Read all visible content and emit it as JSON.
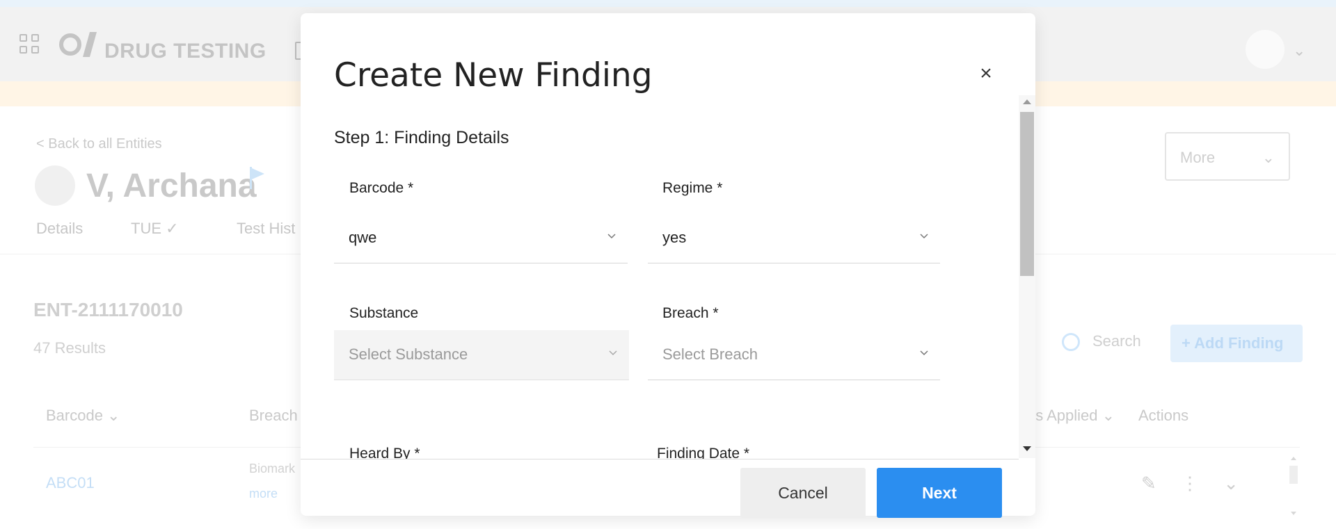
{
  "app": {
    "title": "DRUG TESTING"
  },
  "entity": {
    "back_label": "< Back to all Entities",
    "name": "V, Archana",
    "tabs": [
      {
        "label": "Details"
      },
      {
        "label": "TUE ✓"
      },
      {
        "label": "Test Hist"
      }
    ],
    "more_label": "More",
    "id": "ENT-2111170010",
    "results": "47 Results",
    "search_label": "Search",
    "add_finding_label": "+ Add Finding",
    "table_headers": [
      "Barcode ⌄",
      "Breach",
      "ns Applied ⌄",
      "Actions"
    ],
    "rows": [
      {
        "barcode": "ABC01",
        "breach": "Biomark",
        "more": "more"
      }
    ]
  },
  "modal": {
    "title": "Create New Finding",
    "close_label": "×",
    "step_title": "Step 1: Finding Details",
    "fields": {
      "barcode": {
        "label": "Barcode *",
        "value": "qwe"
      },
      "regime": {
        "label": "Regime *",
        "value": "yes"
      },
      "substance": {
        "label": "Substance",
        "placeholder": "Select Substance",
        "disabled": true
      },
      "breach": {
        "label": "Breach *",
        "placeholder": "Select Breach"
      },
      "heard_by": {
        "label": "Heard By *"
      },
      "finding_date": {
        "label": "Finding Date *"
      }
    },
    "cancel_label": "Cancel",
    "next_label": "Next"
  },
  "colors": {
    "primary": "#2b8ef0",
    "overlay_banner": "#fff5e6"
  }
}
